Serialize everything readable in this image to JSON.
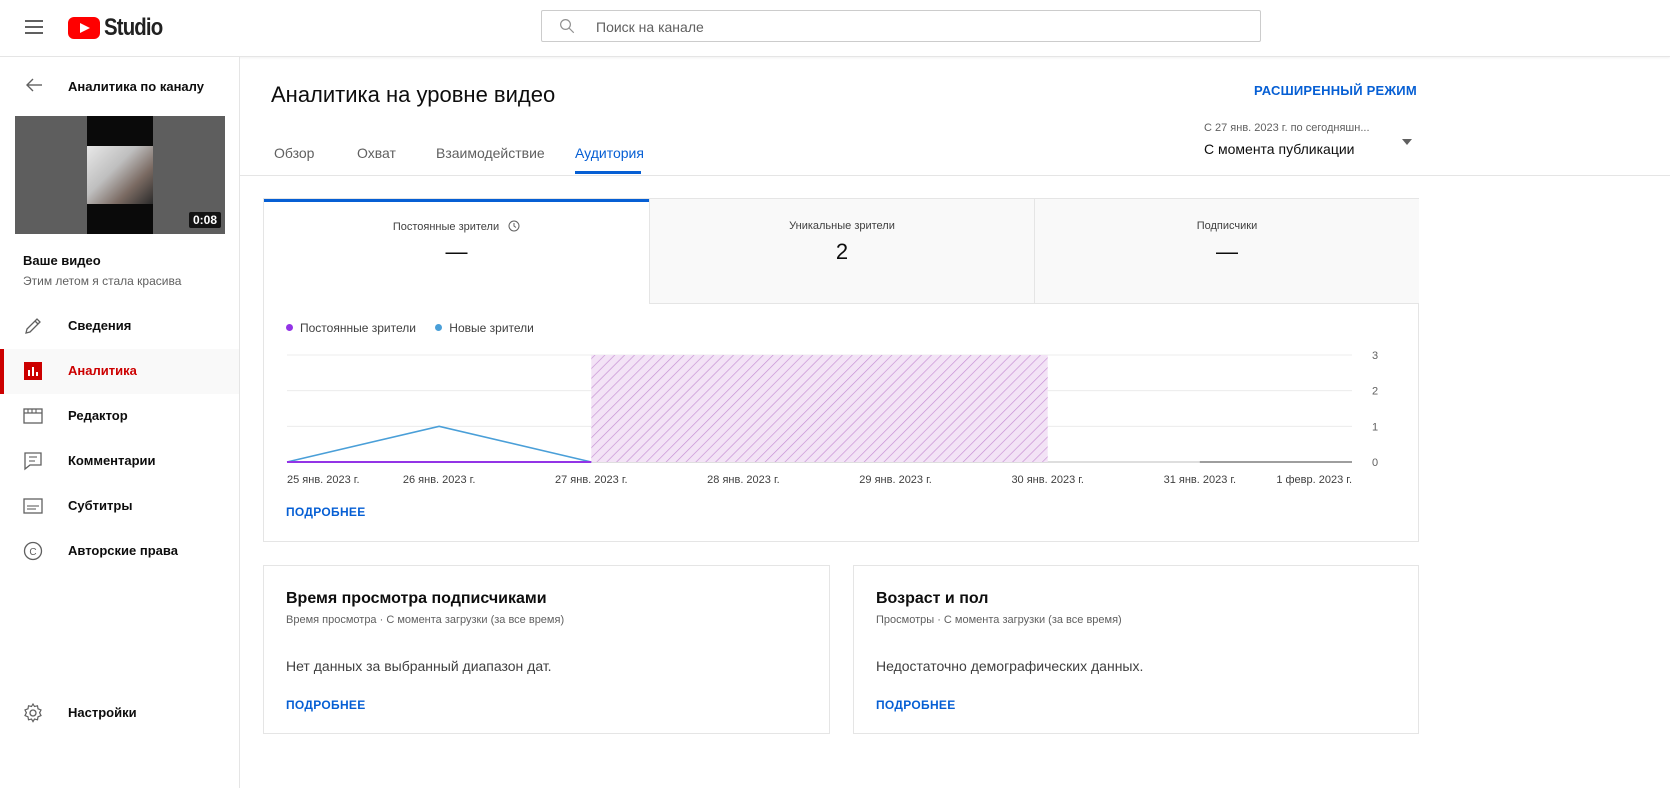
{
  "header": {
    "logo_text": "Studio",
    "search_placeholder": "Поиск на канале"
  },
  "sidebar": {
    "back_label": "Аналитика по каналу",
    "video_duration": "0:08",
    "your_video_title": "Ваше видео",
    "video_name": "Этим летом я стала красива",
    "items": [
      {
        "label": "Сведения",
        "icon": "pencil-icon"
      },
      {
        "label": "Аналитика",
        "icon": "analytics-icon"
      },
      {
        "label": "Редактор",
        "icon": "film-icon"
      },
      {
        "label": "Комментарии",
        "icon": "comment-icon"
      },
      {
        "label": "Субтитры",
        "icon": "subtitles-icon"
      },
      {
        "label": "Авторские права",
        "icon": "copyright-icon"
      }
    ],
    "settings_label": "Настройки"
  },
  "main": {
    "title": "Аналитика на уровне видео",
    "advanced_mode": "РАСШИРЕННЫЙ РЕЖИМ",
    "tabs": [
      "Обзор",
      "Охват",
      "Взаимодействие",
      "Аудитория"
    ],
    "active_tab": "Аудитория",
    "date_range_small": "С 27 янв. 2023 г. по сегодняшн...",
    "date_range_main": "С момента публикации"
  },
  "metrics": [
    {
      "label": "Постоянные зрители",
      "value": "—"
    },
    {
      "label": "Уникальные зрители",
      "value": "2"
    },
    {
      "label": "Подписчики",
      "value": "—"
    }
  ],
  "chart_data": {
    "type": "line",
    "x": [
      "25 янв. 2023 г.",
      "26 янв. 2023 г.",
      "27 янв. 2023 г.",
      "28 янв. 2023 г.",
      "29 янв. 2023 г.",
      "30 янв. 2023 г.",
      "31 янв. 2023 г.",
      "1 февр. 2023 г."
    ],
    "series": [
      {
        "name": "Постоянные зрители",
        "color": "#9334e6",
        "values": [
          0,
          0,
          0,
          null,
          null,
          null,
          0,
          0
        ]
      },
      {
        "name": "Новые зрители",
        "color": "#4a9fd8",
        "values": [
          0,
          1,
          0,
          null,
          null,
          null,
          0,
          0
        ]
      }
    ],
    "no_data_range": [
      "27 янв. 2023 г.",
      "30 янв. 2023 г."
    ],
    "ylim": [
      0,
      3
    ],
    "yticks": [
      0,
      1,
      2,
      3
    ],
    "y_axis_side": "right",
    "grid": true,
    "legend": "top-left"
  },
  "chart_more": "ПОДРОБНЕЕ",
  "cards": [
    {
      "title": "Время просмотра подписчиками",
      "subtitle": "Время просмотра · С момента загрузки (за все время)",
      "message": "Нет данных за выбранный диапазон дат.",
      "more": "ПОДРОБНЕЕ"
    },
    {
      "title": "Возраст и пол",
      "subtitle": "Просмотры · С момента загрузки (за все время)",
      "message": "Недостаточно демографических данных.",
      "more": "ПОДРОБНЕЕ"
    }
  ]
}
